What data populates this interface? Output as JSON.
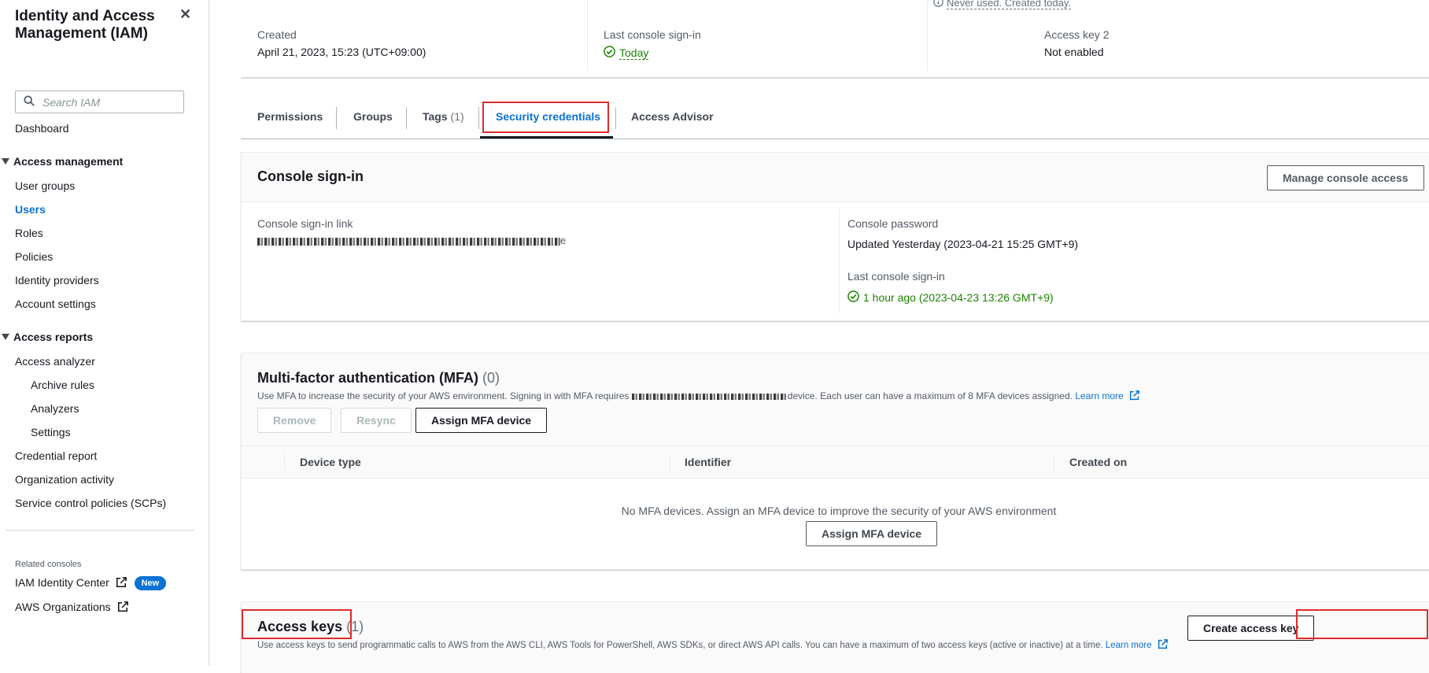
{
  "sidebar": {
    "title": "Identity and Access Management (IAM)",
    "search_placeholder": "Search IAM",
    "dashboard": "Dashboard",
    "access_management": {
      "label": "Access management",
      "items": [
        "User groups",
        "Users",
        "Roles",
        "Policies",
        "Identity providers",
        "Account settings"
      ],
      "active": "Users"
    },
    "access_reports": {
      "label": "Access reports",
      "items": [
        "Access analyzer",
        "Archive rules",
        "Analyzers",
        "Settings",
        "Credential report",
        "Organization activity",
        "Service control policies (SCPs)"
      ]
    },
    "related_consoles": {
      "label": "Related consoles",
      "identity_center": "IAM Identity Center",
      "new_badge": "New",
      "organizations": "AWS Organizations"
    }
  },
  "summary": {
    "access_key1_note": "Never used. Created today.",
    "created_label": "Created",
    "created_value": "April 21, 2023, 15:23 (UTC+09:00)",
    "last_signin_label": "Last console sign-in",
    "last_signin_value": "Today",
    "access_key2_label": "Access key 2",
    "access_key2_value": "Not enabled"
  },
  "tabs": [
    {
      "label": "Permissions"
    },
    {
      "label": "Groups"
    },
    {
      "label": "Tags",
      "count": "(1)"
    },
    {
      "label": "Security credentials"
    },
    {
      "label": "Access Advisor"
    }
  ],
  "active_tab": "Security credentials",
  "console_signin": {
    "title": "Console sign-in",
    "manage_button": "Manage console access",
    "link_label": "Console sign-in link",
    "link_suffix": "e",
    "password_label": "Console password",
    "password_value": "Updated Yesterday (2023-04-21 15:25 GMT+9)",
    "last_signin_label": "Last console sign-in",
    "last_signin_value": "1 hour ago (2023-04-23 13:26 GMT+9)"
  },
  "mfa": {
    "title": "Multi-factor authentication (MFA)",
    "count": "(0)",
    "desc_prefix": "Use MFA to increase the security of your AWS environment. Signing in with MFA requires",
    "desc_suffix": "device. Each user can have a maximum of 8 MFA devices assigned.",
    "learn_more": "Learn more",
    "remove_button": "Remove",
    "resync_button": "Resync",
    "assign_button": "Assign MFA device",
    "columns": [
      "Device type",
      "Identifier",
      "Created on"
    ],
    "empty_text": "No MFA devices. Assign an MFA device to improve the security of your AWS environment",
    "empty_assign_button": "Assign MFA device"
  },
  "access_keys": {
    "title": "Access keys",
    "count": "(1)",
    "desc": "Use access keys to send programmatic calls to AWS from the AWS CLI, AWS Tools for PowerShell, AWS SDKs, or direct AWS API calls. You can have a maximum of two access keys (active or inactive) at a time.",
    "learn_more": "Learn more",
    "create_button": "Create access key"
  },
  "colors": {
    "link_blue": "#0972d3",
    "success_green": "#1d8102",
    "highlight_red": "#e02a2a",
    "badge_blue": "#0972d3"
  },
  "icons": [
    "close-icon",
    "search-icon",
    "caret-down-icon",
    "external-link-icon",
    "check-circle-icon",
    "info-icon"
  ]
}
